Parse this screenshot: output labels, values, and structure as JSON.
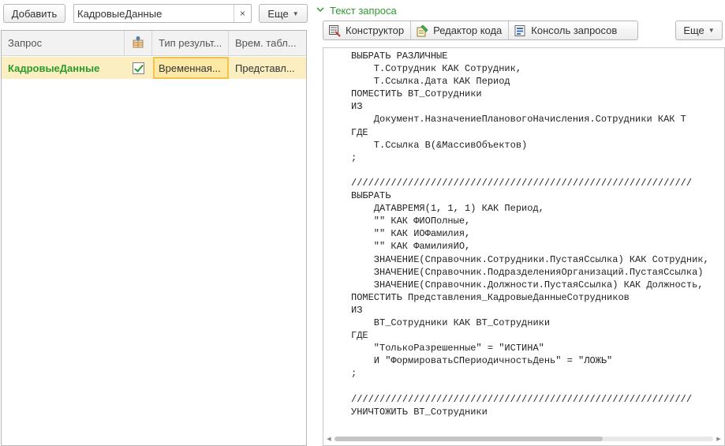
{
  "left_toolbar": {
    "add_label": "Добавить",
    "search_value": "КадровыеДанные",
    "clear_glyph": "×",
    "more_label": "Еще"
  },
  "grid": {
    "headers": {
      "query": "Запрос",
      "icon": "table-icon",
      "result_type": "Тип результ...",
      "temp_table": "Врем. табл..."
    },
    "rows": [
      {
        "query": "КадровыеДанные",
        "checked": true,
        "result_type": "Временная...",
        "temp_table": "Представл..."
      }
    ]
  },
  "right_pane": {
    "section_title": "Текст запроса",
    "toolbar": {
      "constructor_label": "Конструктор",
      "code_editor_label": "Редактор кода",
      "console_label": "Консоль запросов",
      "more_label": "Еще"
    },
    "code_lines": [
      "ВЫБРАТЬ РАЗЛИЧНЫЕ",
      "    Т.Сотрудник КАК Сотрудник,",
      "    Т.Ссылка.Дата КАК Период",
      "ПОМЕСТИТЬ ВТ_Сотрудники",
      "ИЗ",
      "    Документ.НазначениеПлановогоНачисления.Сотрудники КАК Т",
      "ГДЕ",
      "    Т.Ссылка В(&МассивОбъектов)",
      ";",
      "",
      "////////////////////////////////////////////////////////////",
      "ВЫБРАТЬ",
      "    ДАТАВРЕМЯ(1, 1, 1) КАК Период,",
      "    \"\" КАК ФИОПолные,",
      "    \"\" КАК ИОФамилия,",
      "    \"\" КАК ФамилияИО,",
      "    ЗНАЧЕНИЕ(Справочник.Сотрудники.ПустаяСсылка) КАК Сотрудник,",
      "    ЗНАЧЕНИЕ(Справочник.ПодразделенияОрганизаций.ПустаяСсылка)",
      "    ЗНАЧЕНИЕ(Справочник.Должности.ПустаяСсылка) КАК Должность,",
      "ПОМЕСТИТЬ Представления_КадровыеДанныеСотрудников",
      "ИЗ",
      "    ВТ_Сотрудники КАК ВТ_Сотрудники",
      "ГДЕ",
      "    \"ТолькоРазрешенные\" = \"ИСТИНА\"",
      "    И \"ФормироватьСПериодичностьДень\" = \"ЛОЖЬ\"",
      ";",
      "",
      "////////////////////////////////////////////////////////////",
      "УНИЧТОЖИТЬ ВТ_Сотрудники"
    ],
    "scroll_position": 0.0
  },
  "colors": {
    "accent_green": "#2c9a2c",
    "row_highlight": "#fbeec0",
    "cell_focus_border": "#f3c34a"
  }
}
